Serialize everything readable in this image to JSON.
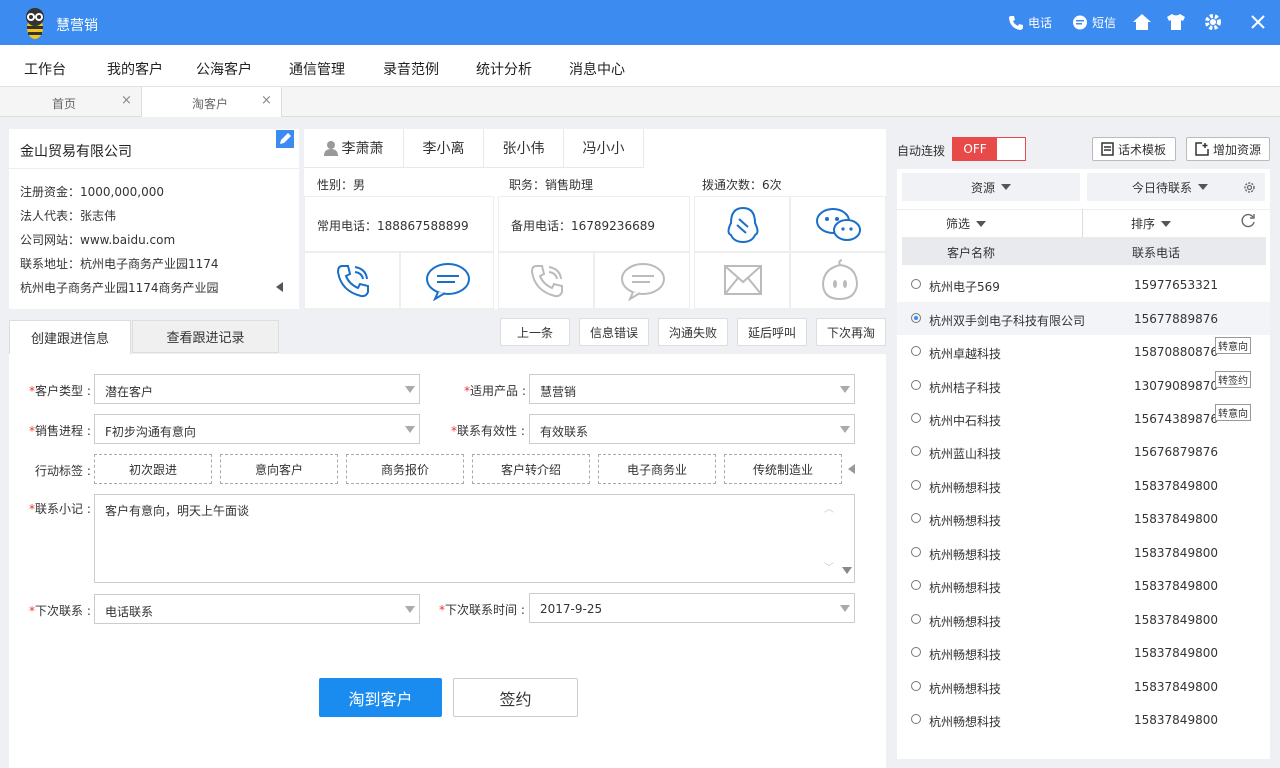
{
  "app": {
    "title": "慧营销"
  },
  "titlebar": {
    "phone_label": "电话",
    "sms_label": "短信"
  },
  "menu": [
    "工作台",
    "我的客户",
    "公海客户",
    "通信管理",
    "录音范例",
    "统计分析",
    "消息中心"
  ],
  "page_tabs": [
    {
      "label": "首页"
    },
    {
      "label": "淘客户"
    }
  ],
  "company": {
    "name": "金山贸易有限公司",
    "capital": "注册资金：1000,000,000",
    "legal_rep": "法人代表：张志伟",
    "website": "公司网站：www.baidu.com",
    "address": "联系地址：杭州电子商务产业园1174",
    "address2": "杭州电子商务产业园1174商务产业园"
  },
  "contacts": {
    "people": [
      "李萧萧",
      "李小离",
      "张小伟",
      "冯小小"
    ],
    "gender": "性别：男",
    "position": "职务：销售助理",
    "dial_count": "拨通次数：6次",
    "main_phone": "常用电话：188867588899",
    "backup_phone": "备用电话：16789236689"
  },
  "subtabs": [
    "创建跟进信息",
    "查看跟进记录"
  ],
  "actions": [
    "上一条",
    "信息错误",
    "沟通失败",
    "延后呼叫",
    "下次再淘"
  ],
  "form": {
    "customer_type_label": "客户类型",
    "customer_type": "潜在客户",
    "product_label": "适用产品",
    "product": "慧营销",
    "sales_stage_label": "销售进程",
    "sales_stage": "F初步沟通有意向",
    "validity_label": "联系有效性",
    "validity": "有效联系",
    "tags_label": "行动标签",
    "tags": [
      "初次跟进",
      "意向客户",
      "商务报价",
      "客户转介绍",
      "电子商务业",
      "传统制造业"
    ],
    "note_label": "联系小记",
    "note": "客户有意向，明天上午面谈",
    "next_contact_label": "下次联系",
    "next_contact": "电话联系",
    "next_time_label": "下次联系时间",
    "next_time": "2017-9-25",
    "submit": "淘到客户",
    "sign": "签约"
  },
  "right": {
    "auto_connect": "自动连拨",
    "toggle": "OFF",
    "template_btn": "话术模板",
    "add_btn": "增加资源",
    "filter_resource": "资源",
    "filter_today": "今日待联系",
    "filter": "筛选",
    "sort": "排序",
    "col_name": "客户名称",
    "col_phone": "联系电话",
    "rows": [
      {
        "name": "杭州电子569",
        "phone": "15977653321",
        "badge": ""
      },
      {
        "name": "杭州双手剑电子科技有限公司",
        "phone": "15677889876",
        "badge": ""
      },
      {
        "name": "杭州卓越科技",
        "phone": "15870880876",
        "badge": "转意向"
      },
      {
        "name": "杭州桔子科技",
        "phone": "13079089870",
        "badge": "转签约"
      },
      {
        "name": "杭州中石科技",
        "phone": "15674389876",
        "badge": "转意向"
      },
      {
        "name": "杭州蓝山科技",
        "phone": "15676879876",
        "badge": ""
      },
      {
        "name": "杭州畅想科技",
        "phone": "15837849800",
        "badge": ""
      },
      {
        "name": "杭州畅想科技",
        "phone": "15837849800",
        "badge": ""
      },
      {
        "name": "杭州畅想科技",
        "phone": "15837849800",
        "badge": ""
      },
      {
        "name": "杭州畅想科技",
        "phone": "15837849800",
        "badge": ""
      },
      {
        "name": "杭州畅想科技",
        "phone": "15837849800",
        "badge": ""
      },
      {
        "name": "杭州畅想科技",
        "phone": "15837849800",
        "badge": ""
      },
      {
        "name": "杭州畅想科技",
        "phone": "15837849800",
        "badge": ""
      },
      {
        "name": "杭州畅想科技",
        "phone": "15837849800",
        "badge": ""
      }
    ]
  },
  "colors": {
    "primary": "#3b8bf0",
    "accent_red": "#e84a4a",
    "icon_blue": "#1a6fc9",
    "icon_gray": "#bbbbbb"
  }
}
